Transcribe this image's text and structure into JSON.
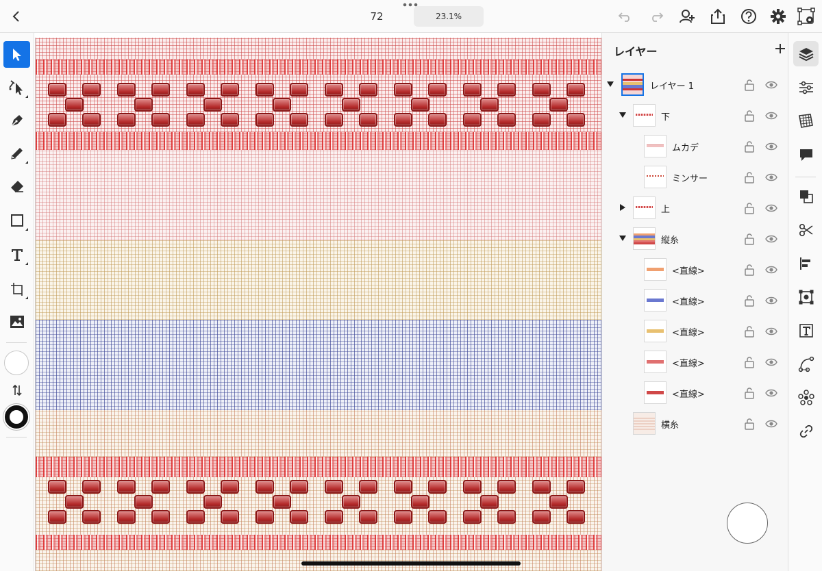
{
  "top_bar": {
    "doc_number": "72",
    "zoom_level": "23.1%"
  },
  "layers_panel": {
    "title": "レイヤー",
    "items": [
      {
        "name": "レイヤー 1",
        "expanded": true
      },
      {
        "name": "下",
        "expanded": true
      },
      {
        "name": "ムカデ"
      },
      {
        "name": "ミンサー"
      },
      {
        "name": "上",
        "expanded": false
      },
      {
        "name": "縦糸",
        "expanded": true
      },
      {
        "name": "<直線>",
        "swatch_color": "#f0a070"
      },
      {
        "name": "<直線>",
        "swatch_color": "#6a78d0"
      },
      {
        "name": "<直線>",
        "swatch_color": "#e8c070"
      },
      {
        "name": "<直線>",
        "swatch_color": "#e07070"
      },
      {
        "name": "<直線>",
        "swatch_color": "#d04848"
      },
      {
        "name": "横糸"
      }
    ]
  },
  "colors": {
    "accent": "#1473e6",
    "motif_red": "#b42a2a",
    "warp_blue": "#3c4696",
    "warp_tan": "#be9650"
  }
}
